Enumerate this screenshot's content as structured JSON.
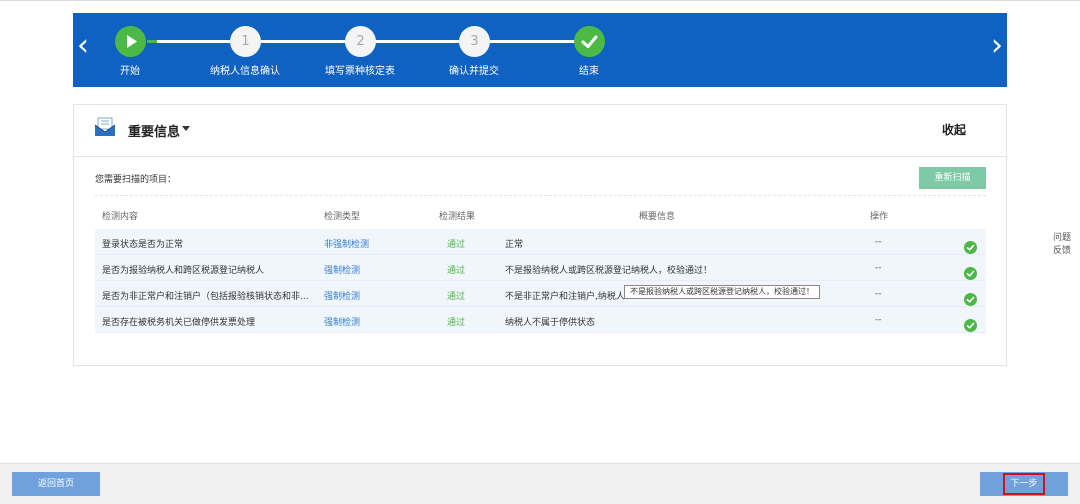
{
  "steps": [
    {
      "label": "开始",
      "marker": "play-icon",
      "state": "done"
    },
    {
      "label": "纳税人信息确认",
      "marker": "1",
      "state": "pending"
    },
    {
      "label": "填写票种核定表",
      "marker": "2",
      "state": "pending"
    },
    {
      "label": "确认并提交",
      "marker": "3",
      "state": "pending"
    },
    {
      "label": "结束",
      "marker": "check-icon",
      "state": "done"
    }
  ],
  "panel": {
    "title": "重要信息",
    "collapse_label": "收起",
    "scan_label": "您需要扫描的项目：",
    "rescan_label": "重新扫描"
  },
  "table": {
    "columns": [
      "检测内容",
      "检测类型",
      "检测结果",
      "概要信息",
      "操作"
    ],
    "rows": [
      {
        "content": "登录状态是否为正常",
        "type": "非强制检测",
        "result": "通过",
        "summary": "正常",
        "op": "--"
      },
      {
        "content": "是否为报验纳税人和跨区税源登记纳税人",
        "type": "强制检测",
        "result": "通过",
        "summary": "不是报验纳税人或跨区税源登记纳税人，校验通过！",
        "op": "--"
      },
      {
        "content": "是否为非正常户和注销户（包括报验核销状态和非...",
        "type": "强制检测",
        "result": "通过",
        "summary": "不是非正常户和注销户,纳税人",
        "op": "--"
      },
      {
        "content": "是否存在被税务机关已做停供发票处理",
        "type": "强制检测",
        "result": "通过",
        "summary": "纳税人不属于停供状态",
        "op": "--"
      }
    ]
  },
  "tooltip": "不是报验纳税人或跨区税源登记纳税人，校验通过！",
  "feedback": {
    "line1": "问题",
    "line2": "反馈"
  },
  "footer": {
    "back_home": "返回首页",
    "next": "下一步"
  },
  "colors": {
    "banner": "#1062c2",
    "success": "#4cb946",
    "link": "#2f7bd6",
    "button": "#6fa2dc",
    "highlight": "#d0101a"
  }
}
